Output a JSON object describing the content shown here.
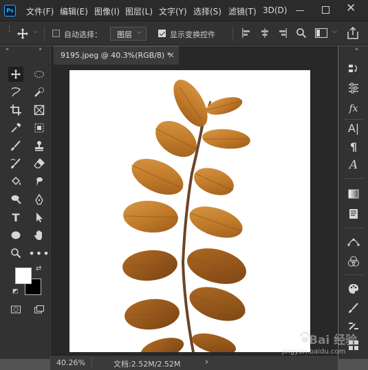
{
  "app": {
    "logo": "Ps"
  },
  "menu": {
    "items": [
      "文件(F)",
      "编辑(E)",
      "图像(I)",
      "图层(L)",
      "文字(Y)",
      "选择(S)",
      "滤镜(T)",
      "3D(D)"
    ]
  },
  "window_controls": {
    "minimize": "minimize-icon",
    "maximize": "maximize-icon",
    "close": "✕"
  },
  "options_bar": {
    "auto_select_label": "自动选择：",
    "auto_select_checked": false,
    "target_value": "图层",
    "show_transform_label": "显示变换控件",
    "show_transform_checked": true
  },
  "document": {
    "tab_title": "9195.jpeg @ 40.3%(RGB/8) *",
    "tab_close": "×"
  },
  "status_bar": {
    "zoom": "40.26%",
    "doc_size": "文档:2.52M/2.52M",
    "arrow": "›"
  },
  "colors": {
    "foreground": "#ffffff",
    "background": "#000000",
    "accent": "#31a8ff",
    "leaf": "#c27c2a",
    "stem": "#5a3a22"
  },
  "watermark": {
    "brand": "Bai  经验",
    "url": "jingyan.baidu.com"
  }
}
